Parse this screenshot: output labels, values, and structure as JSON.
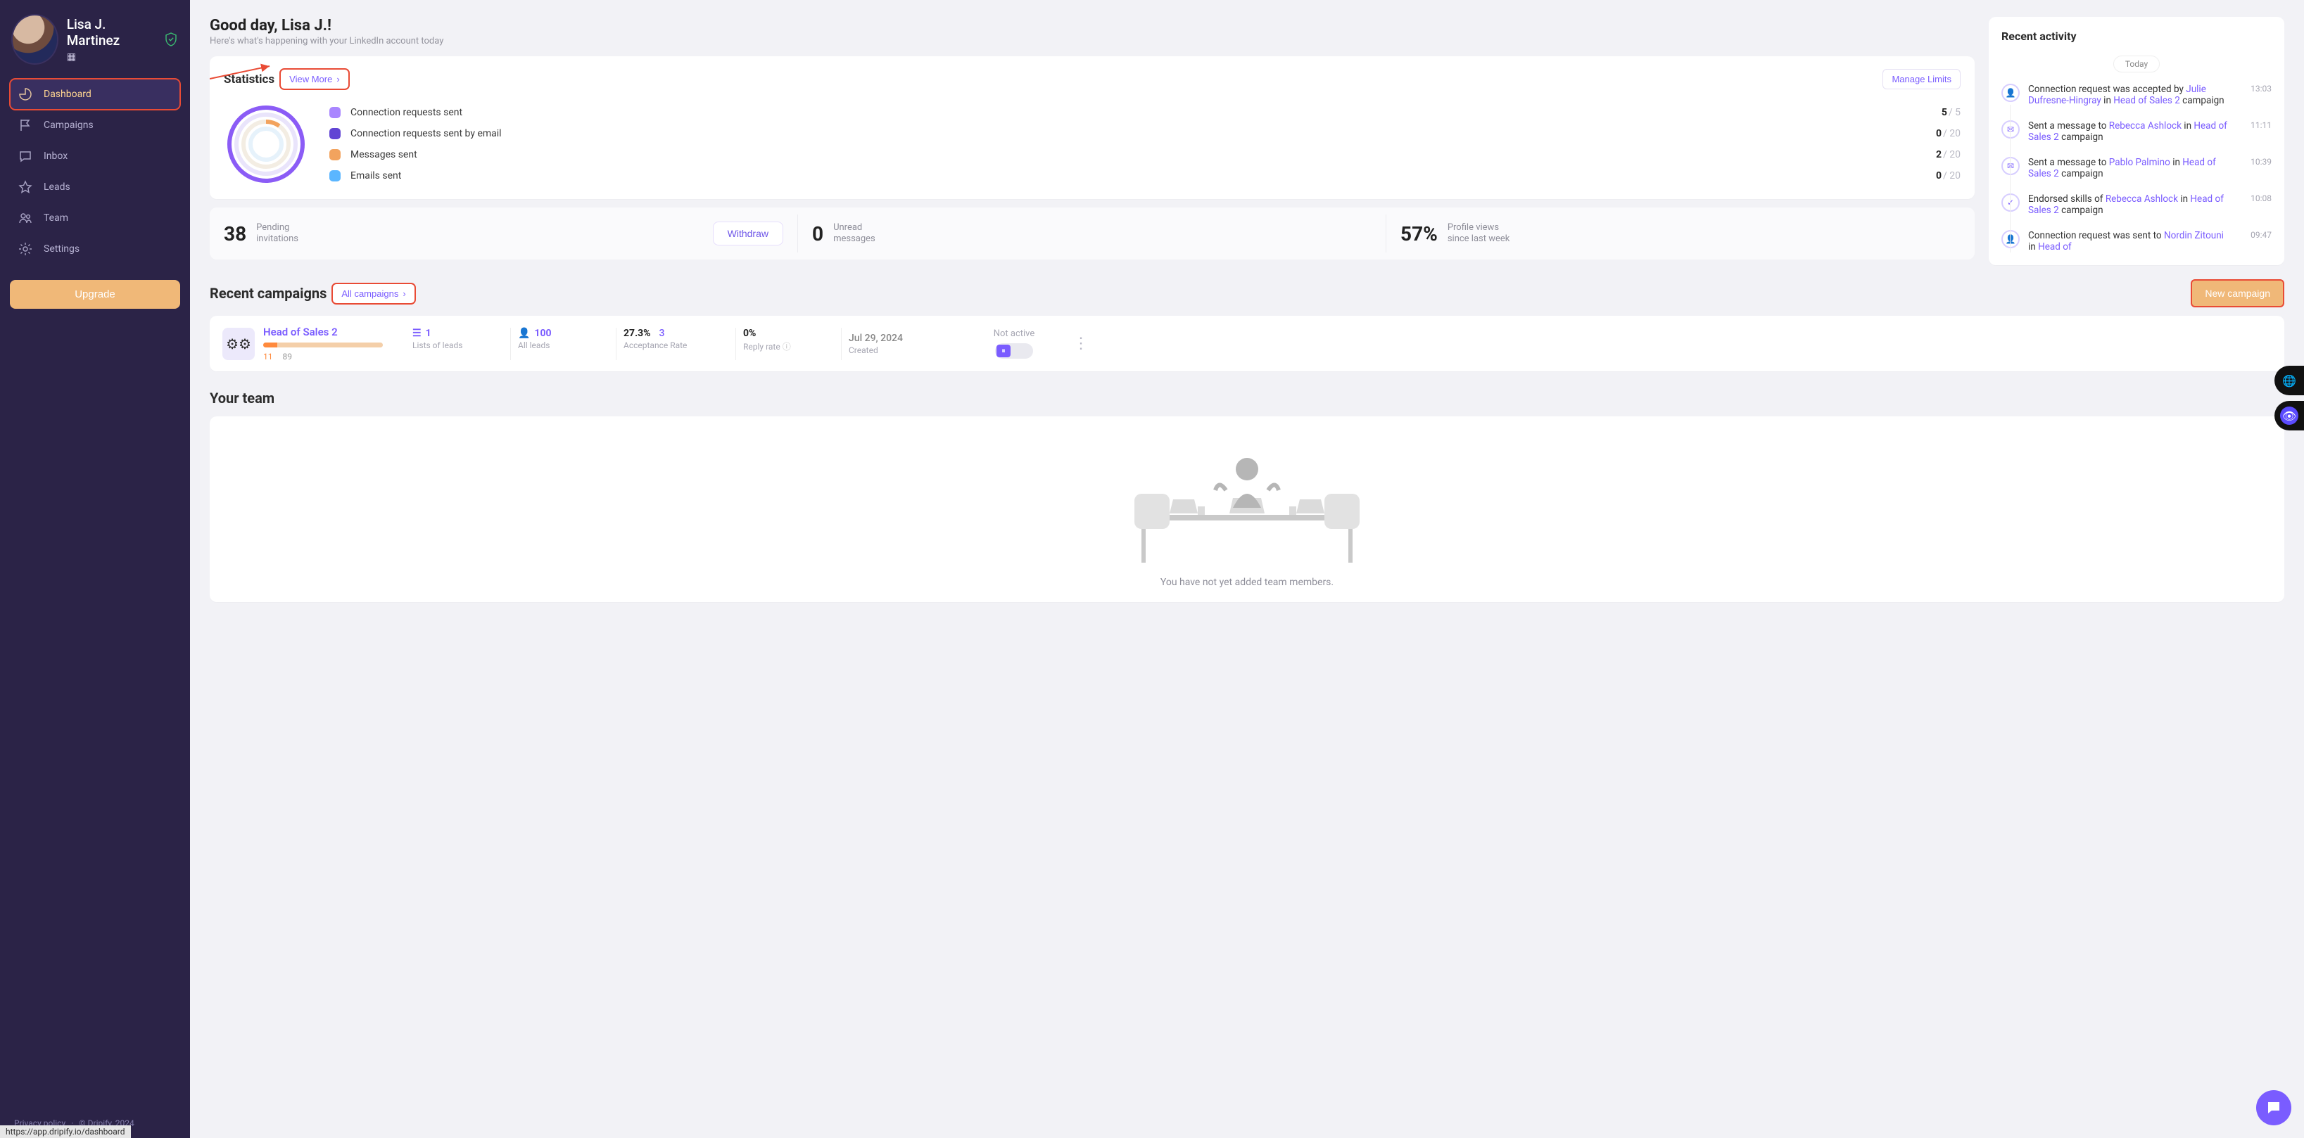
{
  "sidebar": {
    "user_name": "Lisa J. Martinez",
    "nav": [
      {
        "label": "Dashboard",
        "icon": "◔"
      },
      {
        "label": "Campaigns",
        "icon": "⚑"
      },
      {
        "label": "Inbox",
        "icon": "✉"
      },
      {
        "label": "Leads",
        "icon": "☆"
      },
      {
        "label": "Team",
        "icon": "👥"
      },
      {
        "label": "Settings",
        "icon": "⚙"
      }
    ],
    "upgrade": "Upgrade",
    "privacy": "Privacy policy",
    "copyright": "© Dripify, 2024"
  },
  "greeting": {
    "title": "Good day, Lisa J.!",
    "subtitle": "Here's what's happening with your LinkedIn account today"
  },
  "statistics": {
    "title": "Statistics",
    "view_more": "View More",
    "manage_limits": "Manage Limits",
    "items": [
      {
        "label": "Connection requests sent",
        "value": "5",
        "max": "/ 5",
        "color": "#a986ff"
      },
      {
        "label": "Connection requests sent by email",
        "value": "0",
        "max": "/ 20",
        "color": "#6144d4"
      },
      {
        "label": "Messages sent",
        "value": "2",
        "max": "/ 20",
        "color": "#f2a35e"
      },
      {
        "label": "Emails sent",
        "value": "0",
        "max": "/ 20",
        "color": "#5bb6ff"
      }
    ]
  },
  "kpis": {
    "pending": {
      "value": "38",
      "label1": "Pending",
      "label2": "invitations",
      "withdraw": "Withdraw"
    },
    "unread": {
      "value": "0",
      "label1": "Unread",
      "label2": "messages"
    },
    "views": {
      "value": "57%",
      "label1": "Profile views",
      "label2": "since last week"
    }
  },
  "recent_campaigns": {
    "title": "Recent campaigns",
    "all": "All campaigns",
    "new": "New campaign",
    "row": {
      "name": "Head of Sales 2",
      "count_a": "11",
      "count_b": "89",
      "lists_v": "1",
      "lists_l": "Lists of leads",
      "leads_v": "100",
      "leads_l": "All leads",
      "acc_v": "27.3%",
      "acc_extra": "3",
      "acc_l": "Acceptance Rate",
      "reply_v": "0%",
      "reply_l": "Reply rate",
      "created_v": "Jul 29, 2024",
      "created_l": "Created",
      "status": "Not active"
    }
  },
  "team": {
    "title": "Your team",
    "empty": "You have not yet added team members."
  },
  "activity": {
    "title": "Recent activity",
    "date": "Today",
    "items": [
      {
        "time": "13:03",
        "pre": "Connection request was accepted by ",
        "link1": "Julie Dufresne-Hingray",
        "mid": " in ",
        "link2": "Head of Sales 2",
        "post": " campaign",
        "icon": "👤"
      },
      {
        "time": "11:11",
        "pre": "Sent a message to ",
        "link1": "Rebecca Ashlock",
        "mid": " in ",
        "link2": "Head of Sales 2",
        "post": " campaign",
        "icon": "✉"
      },
      {
        "time": "10:39",
        "pre": "Sent a message to ",
        "link1": "Pablo Palmino",
        "mid": " in ",
        "link2": "Head of Sales 2",
        "post": " campaign",
        "icon": "✉"
      },
      {
        "time": "10:08",
        "pre": "Endorsed skills of ",
        "link1": "Rebecca Ashlock",
        "mid": " in ",
        "link2": "Head of Sales 2",
        "post": " campaign",
        "icon": "✓"
      },
      {
        "time": "09:47",
        "pre": "Connection request was sent to ",
        "link1": "Nordin Zitouni",
        "mid": " in ",
        "link2": "Head of",
        "post": "",
        "icon": "👤"
      }
    ]
  },
  "status_url": "https://app.dripify.io/dashboard"
}
